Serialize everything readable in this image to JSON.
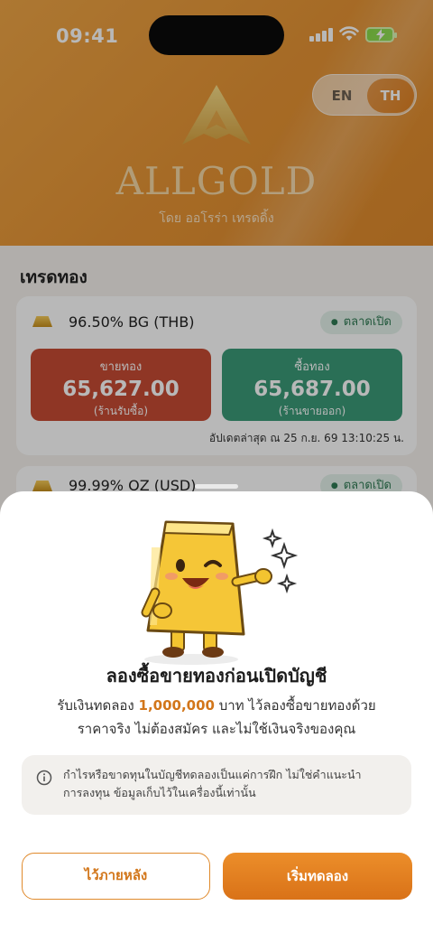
{
  "status_bar": {
    "time": "09:41"
  },
  "header": {
    "lang": {
      "en": "EN",
      "th": "TH",
      "selected": "TH"
    },
    "logo_text": "ALLGOLD",
    "logo_sub": "โดย ออโรร่า เทรดดิ้ง"
  },
  "content": {
    "section_title": "เทรดทอง",
    "cards": [
      {
        "title": "96.50% BG (THB)",
        "status": "ตลาดเปิด",
        "sell": {
          "label": "ขายทอง",
          "value": "65,627.00",
          "sub": "(ร้านรับซื้อ)"
        },
        "buy": {
          "label": "ซื้อทอง",
          "value": "65,687.00",
          "sub": "(ร้านขายออก)"
        },
        "updated": "อัปเดตล่าสุด ณ 25 ก.ย. 69 13:10:25 น."
      },
      {
        "title": "99.99% OZ (USD)",
        "status": "ตลาดเปิด"
      }
    ]
  },
  "sheet": {
    "title": "ลองซื้อขายทองก่อนเปิดบัญชี",
    "body_prefix": "รับเงินทดลอง ",
    "body_amount": "1,000,000",
    "body_suffix": " บาท ไว้ลองซื้อขายทองด้วย",
    "body_line2": "ราคาจริง ไม่ต้องสมัคร และไม่ใช้เงินจริงของคุณ",
    "note_line1": "กำไรหรือขาดทุนในบัญชีทดลองเป็นแค่การฝึก ไม่ใช่คำแนะนำ",
    "note_line2": "การลงทุน ข้อมูลเก็บไว้ในเครื่องนี้เท่านั้น",
    "later_button": "ไว้ภายหลัง",
    "start_button": "เริ่มทดลอง"
  },
  "colors": {
    "header_orange": "#e79535",
    "accent": "#d97218",
    "sell_red": "#c64b34",
    "buy_green": "#3b9a78"
  }
}
